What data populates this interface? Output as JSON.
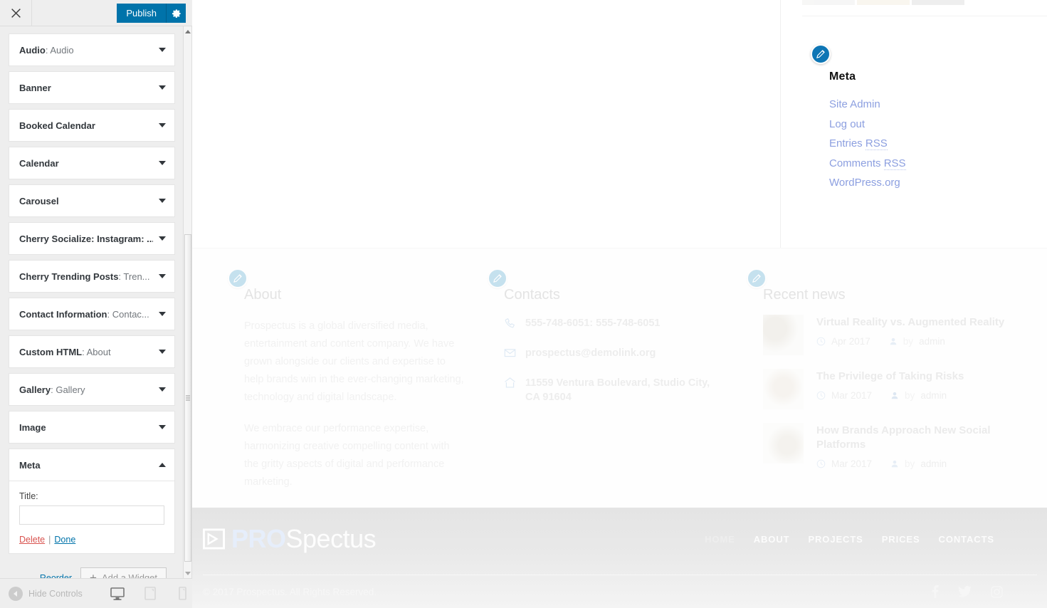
{
  "customizer": {
    "close_label": "Close",
    "publish_label": "Publish",
    "settings_label": "Publish settings",
    "widgets": [
      {
        "name": "Audio",
        "instance": "Audio",
        "open": false
      },
      {
        "name": "Banner",
        "instance": "",
        "open": false
      },
      {
        "name": "Booked Calendar",
        "instance": "",
        "open": false
      },
      {
        "name": "Calendar",
        "instance": "",
        "open": false
      },
      {
        "name": "Carousel",
        "instance": "",
        "open": false
      },
      {
        "name": "Cherry Socialize: Instagram: ...",
        "instance": "",
        "open": false
      },
      {
        "name": "Cherry Trending Posts",
        "instance": "Tren...",
        "open": false
      },
      {
        "name": "Contact Information",
        "instance": "Contac...",
        "open": false
      },
      {
        "name": "Custom HTML",
        "instance": "About",
        "open": false
      },
      {
        "name": "Gallery",
        "instance": "Gallery",
        "open": false
      },
      {
        "name": "Image",
        "instance": "",
        "open": false
      },
      {
        "name": "Meta",
        "instance": "",
        "open": true
      }
    ],
    "open_widget": {
      "title_label": "Title:",
      "title_value": "",
      "title_placeholder": "",
      "delete_label": "Delete",
      "separator": "|",
      "done_label": "Done"
    },
    "reorder_label": "Reorder",
    "add_widget_label": "Add a Widget",
    "hide_controls_label": "Hide Controls",
    "devices": [
      {
        "name": "desktop",
        "label": "Enter desktop preview mode",
        "active": true
      },
      {
        "name": "tablet",
        "label": "Enter tablet preview mode",
        "active": false
      },
      {
        "name": "mobile",
        "label": "Enter mobile preview mode",
        "active": false
      }
    ],
    "accent_color": "#0073aa"
  },
  "preview": {
    "meta_widget": {
      "title": "Meta",
      "links": [
        {
          "text": "Site Admin",
          "abbr": ""
        },
        {
          "text": "Log out",
          "abbr": ""
        },
        {
          "text": "Entries ",
          "abbr": "RSS"
        },
        {
          "text": "Comments ",
          "abbr": "RSS"
        },
        {
          "text": "WordPress.org",
          "abbr": ""
        }
      ]
    },
    "footer_widgets": {
      "about": {
        "title": "About",
        "paragraphs": [
          "Prospectus is a global diversified media, entertainment and content company. We have grown alongside our clients and expertise to help brands win in the ever-changing marketing, technology and digital landscape.",
          "We embrace our performance expertise, harmonizing creative compelling content with the gritty aspects of digital and performance marketing."
        ]
      },
      "contacts": {
        "title": "Contacts",
        "items": [
          {
            "icon": "phone-icon",
            "text": "555-748-6051: 555-748-6051"
          },
          {
            "icon": "envelope-icon",
            "text": "prospectus@demolink.org"
          },
          {
            "icon": "home-icon",
            "text": "11559 Ventura Boulevard, Studio City, CA 91604"
          }
        ]
      },
      "recent_news": {
        "title": "Recent news",
        "posts": [
          {
            "title": "Virtual Reality vs. Augmented Reality",
            "date": "Apr 2017",
            "author_prefix": "by",
            "author": "admin"
          },
          {
            "title": "The Privilege of Taking Risks",
            "date": "Mar 2017",
            "author_prefix": "by",
            "author": "admin"
          },
          {
            "title": "How Brands Approach New Social Platforms",
            "date": "Mar 2017",
            "author_prefix": "by",
            "author": "admin"
          }
        ]
      }
    },
    "footer": {
      "logo_primary": "PRO",
      "logo_secondary": "Spectus",
      "nav": [
        {
          "label": "HOME",
          "active": true
        },
        {
          "label": "ABOUT",
          "active": false
        },
        {
          "label": "PROJECTS",
          "active": false
        },
        {
          "label": "PRICES",
          "active": false
        },
        {
          "label": "CONTACTS",
          "active": false
        }
      ],
      "copyright": "© 2017 Prospectus. All Rights Reserved.",
      "social": [
        {
          "name": "facebook-icon",
          "label": "Facebook"
        },
        {
          "name": "twitter-icon",
          "label": "Twitter"
        },
        {
          "name": "instagram-icon",
          "label": "Instagram"
        }
      ]
    }
  }
}
